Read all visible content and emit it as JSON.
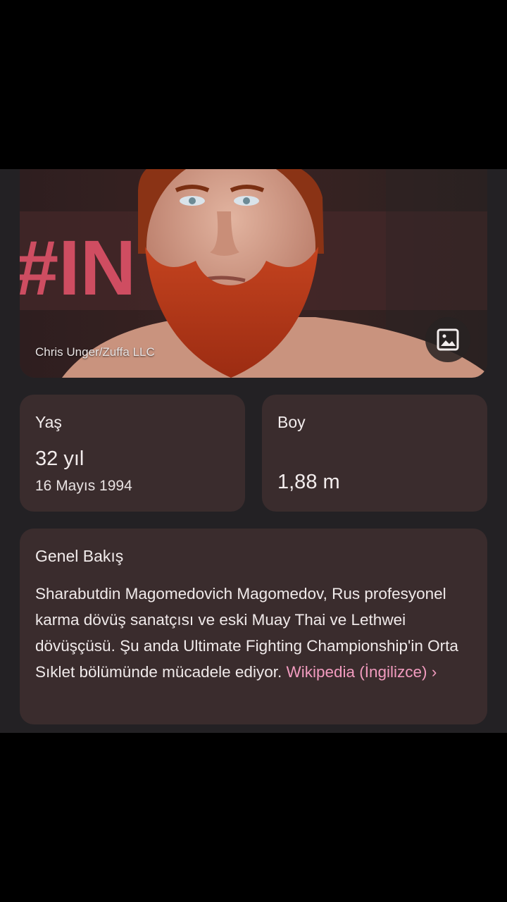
{
  "photo": {
    "credit": "Chris Unger/Zuffa LLC",
    "background_text": "#IN   DH",
    "image_button_icon": "image-icon"
  },
  "age_card": {
    "label": "Yaş",
    "value": "32 yıl",
    "date": "16 Mayıs 1994"
  },
  "height_card": {
    "label": "Boy",
    "value": "1,88 m"
  },
  "overview": {
    "title": "Genel Bakış",
    "text": "Sharabutdin Magomedovich Magomedov, Rus profesyonel karma dövüş sanatçısı ve eski Muay Thai ve Lethwei dövüşçüsü. Şu anda Ultimate Fighting Championship'in Orta Sıklet bölümünde mücadele ediyor.",
    "link_label": "Wikipedia (İngilizce)",
    "link_chevron": "›"
  },
  "colors": {
    "panel_bg": "#232124",
    "card_bg": "#3a2c2d",
    "link": "#f29bbf"
  }
}
